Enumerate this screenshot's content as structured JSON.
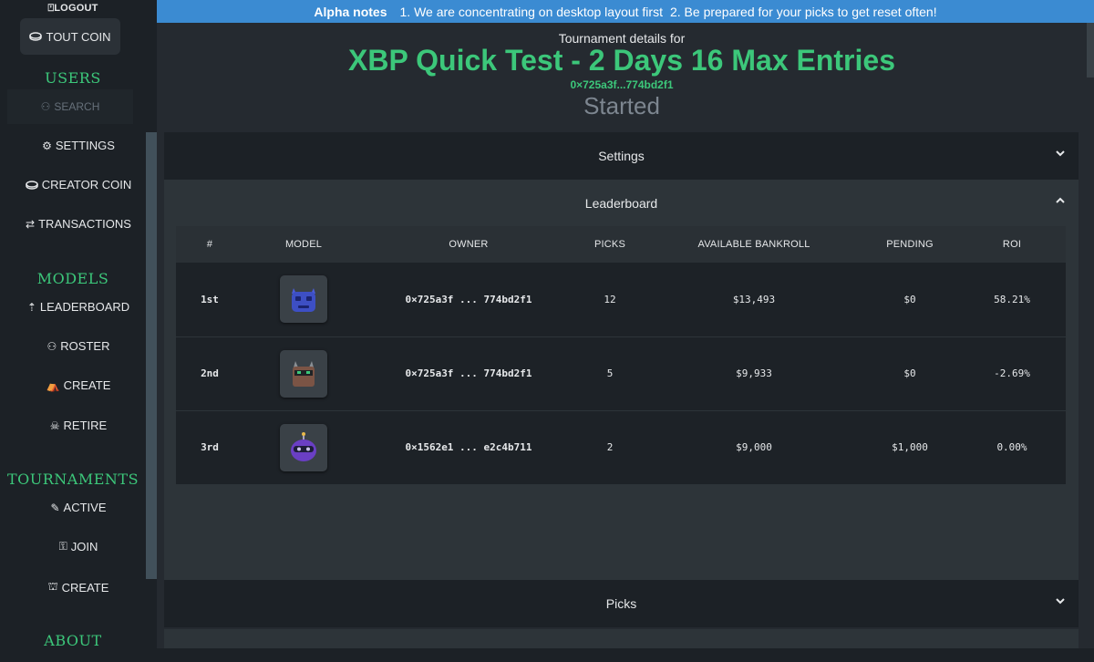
{
  "banner": {
    "title": "Alpha notes",
    "note1": "1. We are concentrating on desktop layout first",
    "note2": "2. Be prepared for your picks to get reset often!"
  },
  "sidebar": {
    "logout": "LOGOUT",
    "tout_coin": "TOUT COIN",
    "users_heading": "USERS",
    "search": "SEARCH",
    "settings": "SETTINGS",
    "creator_coin": "CREATOR COIN",
    "transactions": "TRANSACTIONS",
    "models_heading": "MODELS",
    "leaderboard": "LEADERBOARD",
    "roster": "ROSTER",
    "create_model": "CREATE",
    "retire": "RETIRE",
    "tournaments_heading": "TOURNAMENTS",
    "active": "ACTIVE",
    "join": "JOIN",
    "create_tournament": "CREATE",
    "about_heading": "ABOUT"
  },
  "tournament": {
    "details_for": "Tournament details for",
    "title": "XBP Quick Test - 2 Days 16 Max Entries",
    "address": "0×725a3f...774bd2f1",
    "status": "Started"
  },
  "panels": {
    "settings": "Settings",
    "leaderboard": "Leaderboard",
    "picks": "Picks"
  },
  "leaderboard": {
    "columns": [
      "#",
      "MODEL",
      "OWNER",
      "PICKS",
      "AVAILABLE BANKROLL",
      "PENDING",
      "ROI"
    ],
    "rows": [
      {
        "rank": "1st",
        "owner": "0×725a3f ... 774bd2f1",
        "picks": "12",
        "bankroll": "$13,493",
        "pending": "$0",
        "roi": "58.21%"
      },
      {
        "rank": "2nd",
        "owner": "0×725a3f ... 774bd2f1",
        "picks": "5",
        "bankroll": "$9,933",
        "pending": "$0",
        "roi": "-2.69%"
      },
      {
        "rank": "3rd",
        "owner": "0×1562e1 ... e2c4b711",
        "picks": "2",
        "bankroll": "$9,000",
        "pending": "$1,000",
        "roi": "0.00%"
      }
    ]
  },
  "colors": {
    "accent_green": "#3cc77a",
    "banner_blue": "#3b8bd2",
    "sidebar_bg": "#1c2126"
  }
}
